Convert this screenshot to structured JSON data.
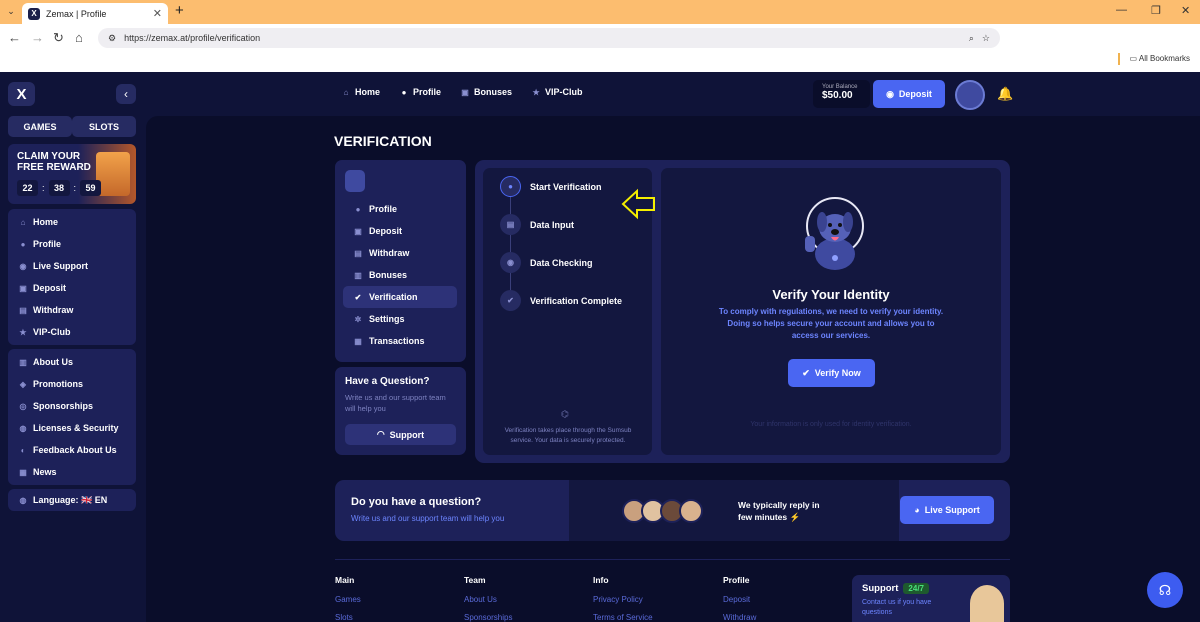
{
  "browser": {
    "tab_title": "Zemax | Profile",
    "favicon": "X",
    "tab_close": "✕",
    "new_tab": "+",
    "menu": "⌄",
    "minimize": "—",
    "maximize": "❐",
    "close": "✕",
    "back": "←",
    "forward": "→",
    "reload": "↻",
    "home": "⌂",
    "url": "https://zemax.at/profile/verification",
    "bookmarks": "All Bookmarks"
  },
  "sidebar": {
    "logo": "X",
    "collapse": "‹",
    "games": "GAMES",
    "slots": "SLOTS",
    "reward_title": "CLAIM YOUR FREE REWARD",
    "timer": [
      "22",
      "38",
      "59"
    ],
    "nav1": [
      {
        "label": "Home",
        "icon": "⌂"
      },
      {
        "label": "Profile",
        "icon": "●"
      },
      {
        "label": "Live Support",
        "icon": "◉"
      },
      {
        "label": "Deposit",
        "icon": "▣"
      },
      {
        "label": "Withdraw",
        "icon": "▤"
      },
      {
        "label": "VIP-Club",
        "icon": "★"
      }
    ],
    "nav2": [
      {
        "label": "About Us",
        "icon": "▥"
      },
      {
        "label": "Promotions",
        "icon": "◈"
      },
      {
        "label": "Sponsorships",
        "icon": "◎"
      },
      {
        "label": "Licenses & Security",
        "icon": "◍"
      },
      {
        "label": "Feedback About Us",
        "icon": "◐"
      },
      {
        "label": "News",
        "icon": "▦"
      }
    ],
    "language": "Language: 🇬🇧 EN"
  },
  "topnav": [
    {
      "label": "Home",
      "icon": "⌂"
    },
    {
      "label": "Profile",
      "icon": "●"
    },
    {
      "label": "Bonuses",
      "icon": "▣"
    },
    {
      "label": "VIP-Club",
      "icon": "★"
    }
  ],
  "header": {
    "balance_label": "Your Balance",
    "balance_value": "$50.00",
    "deposit": "Deposit",
    "bell": "🔔"
  },
  "page": {
    "title": "VERIFICATION",
    "profile_menu": [
      {
        "label": "Profile",
        "icon": "●"
      },
      {
        "label": "Deposit",
        "icon": "▣"
      },
      {
        "label": "Withdraw",
        "icon": "▤"
      },
      {
        "label": "Bonuses",
        "icon": "▥"
      },
      {
        "label": "Verification",
        "icon": "✔"
      },
      {
        "label": "Settings",
        "icon": "✲"
      },
      {
        "label": "Transactions",
        "icon": "▦"
      }
    ],
    "question_title": "Have a Question?",
    "question_text": "Write us and our support team will help you",
    "support_button": "Support",
    "steps": [
      {
        "label": "Start Verification",
        "icon": "●"
      },
      {
        "label": "Data Input",
        "icon": "▤"
      },
      {
        "label": "Data Checking",
        "icon": "◉"
      },
      {
        "label": "Verification Complete",
        "icon": "✔"
      }
    ],
    "steps_note": "Verification takes place through the Sumsub service. Your data is securely protected.",
    "verify_title": "Verify Your Identity",
    "verify_text": "To comply with regulations, we need to verify your identity. Doing so helps secure your account and allows you to access our services.",
    "verify_button": "Verify Now",
    "verify_note": "Your information is only used for identity verification."
  },
  "qbar": {
    "title": "Do you have a question?",
    "subtitle": "Write us and our support team will help you",
    "reply": "We typically reply in few minutes ⚡",
    "live_support": "Live Support"
  },
  "footer": {
    "cols": [
      {
        "head": "Main",
        "links": [
          "Games",
          "Slots"
        ]
      },
      {
        "head": "Team",
        "links": [
          "About Us",
          "Sponsorships"
        ]
      },
      {
        "head": "Info",
        "links": [
          "Privacy Policy",
          "Terms of Service"
        ]
      },
      {
        "head": "Profile",
        "links": [
          "Deposit",
          "Withdraw"
        ]
      }
    ],
    "support_title": "Support",
    "support_badge": "24/7",
    "support_text": "Contact us if you have questions"
  },
  "colors": {
    "accent": "#4a66f2",
    "background": "#0f1338",
    "panel": "#1d2159",
    "browser_bar": "#fcbd6f"
  }
}
